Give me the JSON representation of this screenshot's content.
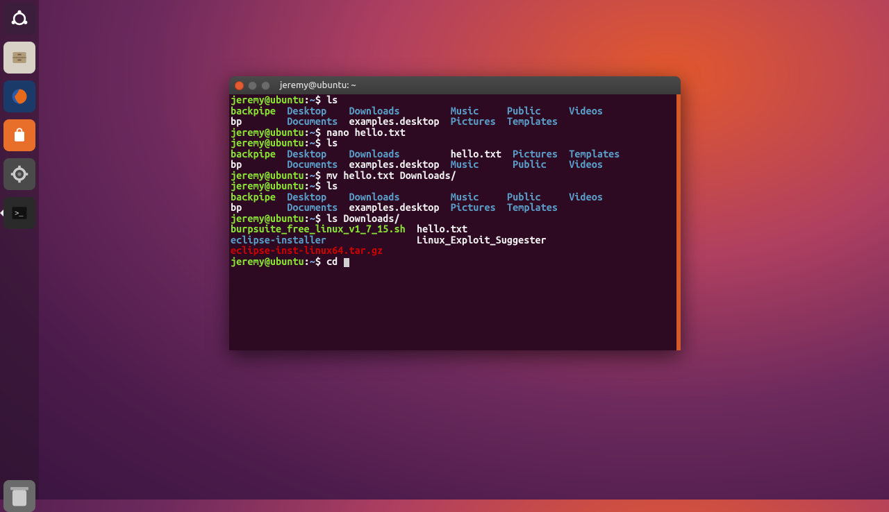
{
  "launcher": {
    "items": [
      {
        "name": "dash-icon"
      },
      {
        "name": "files-icon"
      },
      {
        "name": "firefox-icon"
      },
      {
        "name": "software-icon"
      },
      {
        "name": "settings-icon"
      },
      {
        "name": "terminal-icon"
      }
    ]
  },
  "window": {
    "title": "jeremy@ubuntu: ~"
  },
  "prompt": {
    "user_host": "jeremy@ubuntu",
    "sep": ":",
    "cwd": "~",
    "sigil": "$"
  },
  "session": [
    {
      "type": "cmd",
      "text": "ls"
    },
    {
      "type": "ls",
      "cols": [
        [
          {
            "t": "backpipe",
            "c": "exec"
          },
          {
            "t": "bp",
            "c": "cmd"
          }
        ],
        [
          {
            "t": "Desktop",
            "c": "dir"
          },
          {
            "t": "Documents",
            "c": "dir"
          }
        ],
        [
          {
            "t": "Downloads",
            "c": "dir"
          },
          {
            "t": "examples.desktop",
            "c": "cmd"
          }
        ],
        [
          {
            "t": "Music",
            "c": "dir"
          },
          {
            "t": "Pictures",
            "c": "dir"
          }
        ],
        [
          {
            "t": "Public",
            "c": "dir"
          },
          {
            "t": "Templates",
            "c": "dir"
          }
        ],
        [
          {
            "t": "Videos",
            "c": "dir"
          }
        ]
      ]
    },
    {
      "type": "cmd",
      "text": "nano hello.txt"
    },
    {
      "type": "cmd",
      "text": "ls"
    },
    {
      "type": "ls",
      "cols": [
        [
          {
            "t": "backpipe",
            "c": "exec"
          },
          {
            "t": "bp",
            "c": "cmd"
          }
        ],
        [
          {
            "t": "Desktop",
            "c": "dir"
          },
          {
            "t": "Documents",
            "c": "dir"
          }
        ],
        [
          {
            "t": "Downloads",
            "c": "dir"
          },
          {
            "t": "examples.desktop",
            "c": "cmd"
          }
        ],
        [
          {
            "t": "hello.txt",
            "c": "cmd"
          },
          {
            "t": "Music",
            "c": "dir"
          }
        ],
        [
          {
            "t": "Pictures",
            "c": "dir"
          },
          {
            "t": "Public",
            "c": "dir"
          }
        ],
        [
          {
            "t": "Templates",
            "c": "dir"
          },
          {
            "t": "Videos",
            "c": "dir"
          }
        ]
      ]
    },
    {
      "type": "cmd",
      "text": "mv hello.txt Downloads/"
    },
    {
      "type": "cmd",
      "text": "ls"
    },
    {
      "type": "ls",
      "cols": [
        [
          {
            "t": "backpipe",
            "c": "exec"
          },
          {
            "t": "bp",
            "c": "cmd"
          }
        ],
        [
          {
            "t": "Desktop",
            "c": "dir"
          },
          {
            "t": "Documents",
            "c": "dir"
          }
        ],
        [
          {
            "t": "Downloads",
            "c": "dir"
          },
          {
            "t": "examples.desktop",
            "c": "cmd"
          }
        ],
        [
          {
            "t": "Music",
            "c": "dir"
          },
          {
            "t": "Pictures",
            "c": "dir"
          }
        ],
        [
          {
            "t": "Public",
            "c": "dir"
          },
          {
            "t": "Templates",
            "c": "dir"
          }
        ],
        [
          {
            "t": "Videos",
            "c": "dir"
          }
        ]
      ]
    },
    {
      "type": "cmd",
      "text": "ls Downloads/"
    },
    {
      "type": "ls",
      "cols": [
        [
          {
            "t": "burpsuite_free_linux_v1_7_15.sh",
            "c": "exec"
          },
          {
            "t": "eclipse-installer",
            "c": "dir"
          },
          {
            "t": "eclipse-inst-linux64.tar.gz",
            "c": "arch"
          }
        ],
        [
          {
            "t": "hello.txt",
            "c": "cmd"
          },
          {
            "t": "Linux_Exploit_Suggester",
            "c": "cmd"
          }
        ]
      ]
    },
    {
      "type": "cmd-current",
      "text": "cd "
    }
  ],
  "col_widths_default": [
    10,
    11,
    17,
    11,
    11,
    9
  ],
  "col_widths_alt": [
    10,
    11,
    17,
    11,
    11,
    11,
    9
  ]
}
